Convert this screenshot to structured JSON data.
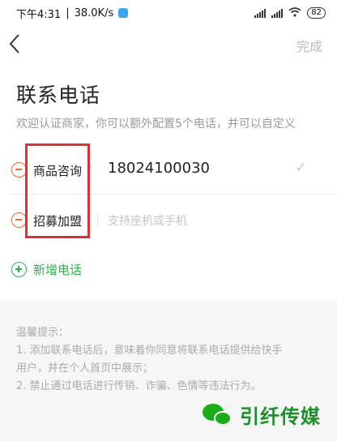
{
  "status_bar": {
    "time": "下午4:31",
    "speed": "38.0K/s",
    "network": "HD 4G",
    "battery": "82"
  },
  "nav": {
    "back_label": "‹",
    "done_label": "完成"
  },
  "page": {
    "title": "联系电话",
    "subtitle": "欢迎认证商家，你可以额外配置5个电话，并可以自定义"
  },
  "phones": [
    {
      "label": "商品咨询",
      "value": "18024100030",
      "placeholder": ""
    },
    {
      "label": "招募加盟",
      "value": "",
      "placeholder": "支持座机或手机"
    }
  ],
  "add_phone": {
    "label": "新增电话"
  },
  "tips": {
    "title": "温馨提示：",
    "lines": [
      "1. 添加联系电话后，意味着你同意将联系电话提供给快手",
      "用户，并在个人首页中展示；",
      "2. 禁止通过电话进行传销、诈骗、色情等违法行为。"
    ]
  },
  "watermark": {
    "text": "引纤传媒"
  },
  "colors": {
    "remove": "#e8693a",
    "add": "#2bb24c",
    "highlight": "#e23030"
  }
}
